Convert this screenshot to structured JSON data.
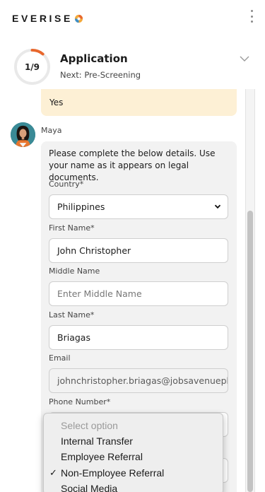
{
  "header": {
    "logo_text_1": "E",
    "logo_text_v": "V",
    "logo_text_2": "ERISE"
  },
  "progress": {
    "step_text": "1/9",
    "fraction": 0.111,
    "accent_color": "#e8672c",
    "title": "Application",
    "next_label": "Next: Pre-Screening"
  },
  "chat": {
    "previous_reply": "Yes",
    "bot_name": "Maya",
    "intro": "Please complete the below details. Use your name as it appears on legal documents.",
    "fields": {
      "country_label": "Country*",
      "country_value": "Philippines",
      "first_name_label": "First Name*",
      "first_name_value": "John Christopher",
      "middle_name_label": "Middle Name",
      "middle_name_placeholder": "Enter Middle Name",
      "last_name_label": "Last Name*",
      "last_name_value": "Briagas",
      "email_label": "Email",
      "email_value": "johnchristopher.briagas@jobsavenueph",
      "phone_label": "Phone Number*"
    }
  },
  "dropdown": {
    "options": [
      {
        "label": "Select option",
        "disabled": true,
        "selected": false
      },
      {
        "label": "Internal Transfer",
        "disabled": false,
        "selected": false
      },
      {
        "label": "Employee Referral",
        "disabled": false,
        "selected": false
      },
      {
        "label": "Non-Employee Referral",
        "disabled": false,
        "selected": true
      },
      {
        "label": "Social Media",
        "disabled": false,
        "selected": false
      }
    ],
    "check_glyph": "✓"
  }
}
